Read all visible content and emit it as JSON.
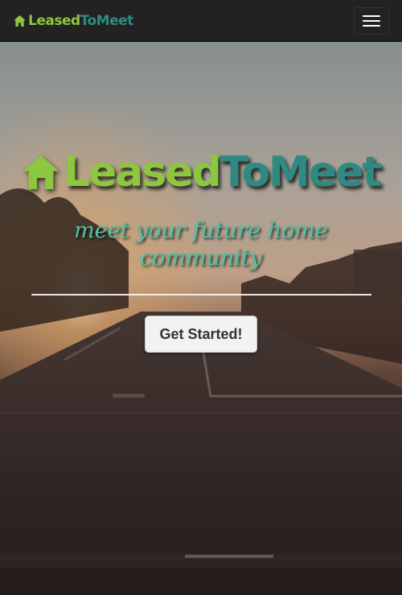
{
  "navbar": {
    "brand_part1": "Leased",
    "brand_part2": "ToMeet",
    "brand_icon": "home-icon",
    "toggle_icon": "hamburger-menu-icon"
  },
  "hero": {
    "title_part1": "Leased",
    "title_part2": "ToMeet",
    "title_icon": "home-icon",
    "tagline": "meet your future home community",
    "cta_label": "Get Started!",
    "background": "sunset street photo"
  },
  "colors": {
    "brand_green": "#8dc63f",
    "brand_teal": "#2e8b82",
    "tagline_teal": "#4ec3a9",
    "navbar_bg": "#222222",
    "button_bg": "#f2f2f2"
  }
}
